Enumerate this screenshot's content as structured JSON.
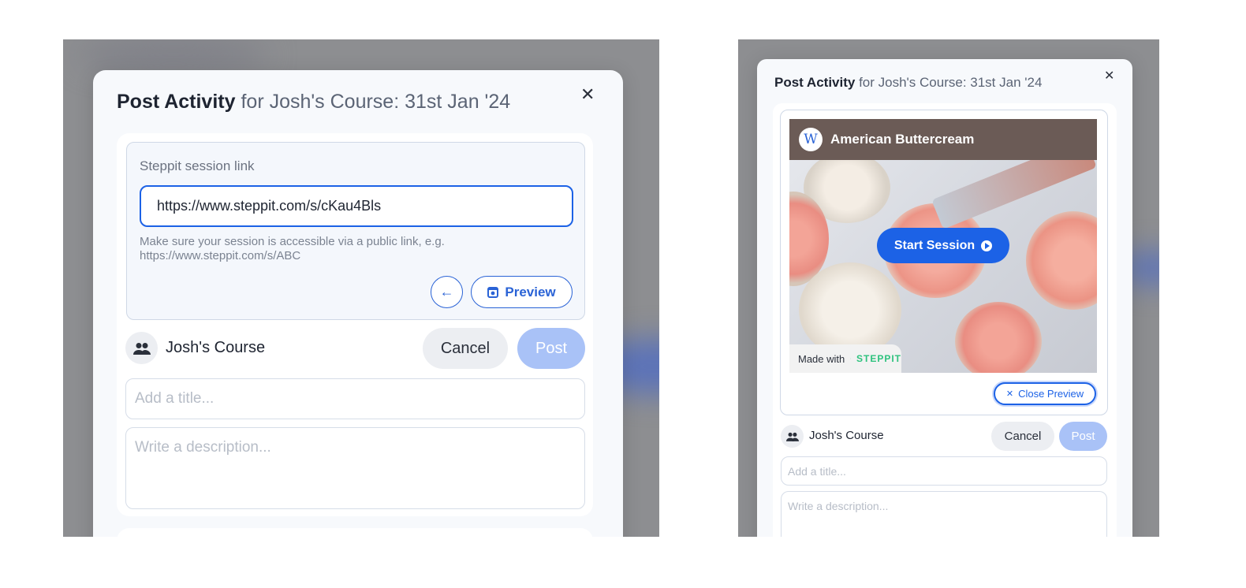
{
  "left_modal": {
    "title_strong": "Post Activity",
    "title_rest": "for Josh's Course: 31st Jan '24",
    "close_glyph": "✕",
    "session_link_label": "Steppit session link",
    "session_link_value": "https://www.steppit.com/s/cKau4Bls",
    "hint_line1": "Make sure your session is accessible via a public link, e.g.",
    "hint_line2": "https://www.steppit.com/s/ABC",
    "back_glyph": "←",
    "preview_label": "Preview",
    "group_name": "Josh's Course",
    "cancel_label": "Cancel",
    "post_label": "Post",
    "title_placeholder": "Add a title...",
    "description_placeholder": "Write a description..."
  },
  "right_modal": {
    "title_strong": "Post Activity",
    "title_rest": "for Josh's Course: 31st Jan '24",
    "close_glyph": "✕",
    "preview": {
      "brand_initial": "W",
      "title": "American Buttercream",
      "start_label": "Start Session",
      "made_with_label": "Made with",
      "logo_text": "STEPPIT"
    },
    "close_preview_label": "Close Preview",
    "group_name": "Josh's Course",
    "cancel_label": "Cancel",
    "post_label": "Post",
    "title_placeholder": "Add a title...",
    "description_placeholder": "Write a description..."
  },
  "colors": {
    "accent": "#1c62e6",
    "post_disabled": "#a9c2f7",
    "logo_green": "#2ec27e",
    "overlay": "#8d8e91"
  },
  "icons": [
    "close-icon",
    "arrow-left-icon",
    "preview-icon",
    "group-icon",
    "play-icon",
    "steppit-logo-icon"
  ]
}
